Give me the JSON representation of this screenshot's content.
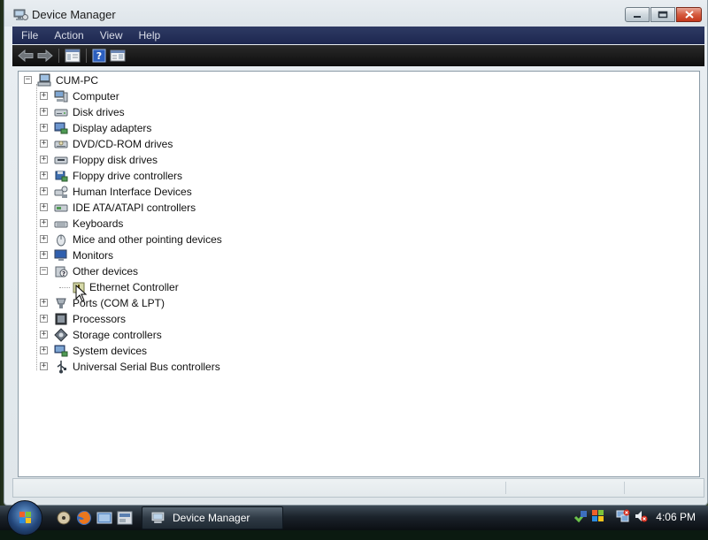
{
  "window": {
    "title": "Device Manager"
  },
  "menubar": {
    "items": [
      "File",
      "Action",
      "View",
      "Help"
    ]
  },
  "tree": {
    "root": "CUM-PC",
    "categories": [
      {
        "label": "Computer",
        "icon": "computer-icon",
        "expanded": false
      },
      {
        "label": "Disk drives",
        "icon": "disk-drive-icon",
        "expanded": false
      },
      {
        "label": "Display adapters",
        "icon": "display-adapter-icon",
        "expanded": false
      },
      {
        "label": "DVD/CD-ROM drives",
        "icon": "dvd-drive-icon",
        "expanded": false
      },
      {
        "label": "Floppy disk drives",
        "icon": "floppy-drive-icon",
        "expanded": false
      },
      {
        "label": "Floppy drive controllers",
        "icon": "floppy-controller-icon",
        "expanded": false
      },
      {
        "label": "Human Interface Devices",
        "icon": "hid-icon",
        "expanded": false
      },
      {
        "label": "IDE ATA/ATAPI controllers",
        "icon": "ide-controller-icon",
        "expanded": false
      },
      {
        "label": "Keyboards",
        "icon": "keyboard-icon",
        "expanded": false
      },
      {
        "label": "Mice and other pointing devices",
        "icon": "mouse-icon",
        "expanded": false
      },
      {
        "label": "Monitors",
        "icon": "monitor-icon",
        "expanded": false
      },
      {
        "label": "Other devices",
        "icon": "other-devices-icon",
        "expanded": true,
        "children": [
          "Ethernet Controller"
        ]
      },
      {
        "label": "Ports (COM & LPT)",
        "icon": "ports-icon",
        "expanded": false
      },
      {
        "label": "Processors",
        "icon": "processor-icon",
        "expanded": false
      },
      {
        "label": "Storage controllers",
        "icon": "storage-controller-icon",
        "expanded": false
      },
      {
        "label": "System devices",
        "icon": "system-devices-icon",
        "expanded": false
      },
      {
        "label": "Universal Serial Bus controllers",
        "icon": "usb-icon",
        "expanded": false
      }
    ]
  },
  "taskbar": {
    "active_window": "Device Manager",
    "clock": "4:06 PM"
  },
  "colors": {
    "menubar": "#1d2750",
    "toolbar": "#0d0d0d",
    "close_button": "#c5381c"
  }
}
